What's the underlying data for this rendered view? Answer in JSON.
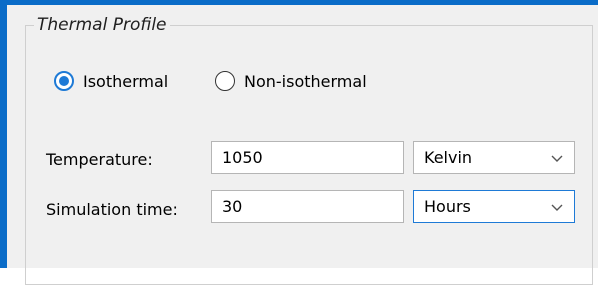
{
  "group": {
    "title": "Thermal Profile"
  },
  "thermal_mode": {
    "options": [
      {
        "label": "Isothermal",
        "selected": true
      },
      {
        "label": "Non-isothermal",
        "selected": false
      }
    ]
  },
  "temperature": {
    "label": "Temperature:",
    "value": "1050",
    "unit": "Kelvin"
  },
  "simulation_time": {
    "label": "Simulation time:",
    "value": "30",
    "unit": "Hours"
  },
  "colors": {
    "accent": "#1e7ad6",
    "window_border": "#0a6cc8",
    "panel_background": "#f0f0f0"
  }
}
